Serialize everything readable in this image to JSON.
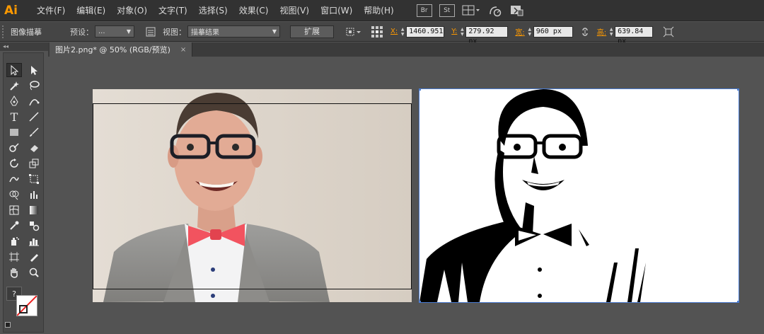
{
  "app": {
    "logo": "Ai"
  },
  "menu": [
    "文件(F)",
    "编辑(E)",
    "对象(O)",
    "文字(T)",
    "选择(S)",
    "效果(C)",
    "视图(V)",
    "窗口(W)",
    "帮助(H)"
  ],
  "menu_icons": [
    "Br",
    "St"
  ],
  "control": {
    "title": "图像描摹",
    "preset_label": "预设：",
    "preset_value": "...",
    "view_label": "视图：",
    "view_value": "描摹结果",
    "expand_button": "扩展",
    "x_label": "X:",
    "x_value": "1460.951",
    "y_label": "Y:",
    "y_value": "279.92 px",
    "w_label": "宽:",
    "w_value": "960 px",
    "h_label": "高:",
    "h_value": "639.84 px"
  },
  "tab": {
    "label": "图片2.png* @ 50% (RGB/预览)",
    "close": "×"
  },
  "toolbox": {
    "collapse": "◂◂",
    "fill_stroke_help": "?"
  },
  "colors": {
    "accent": "#ff9a00",
    "selection": "#4a7bd0"
  }
}
